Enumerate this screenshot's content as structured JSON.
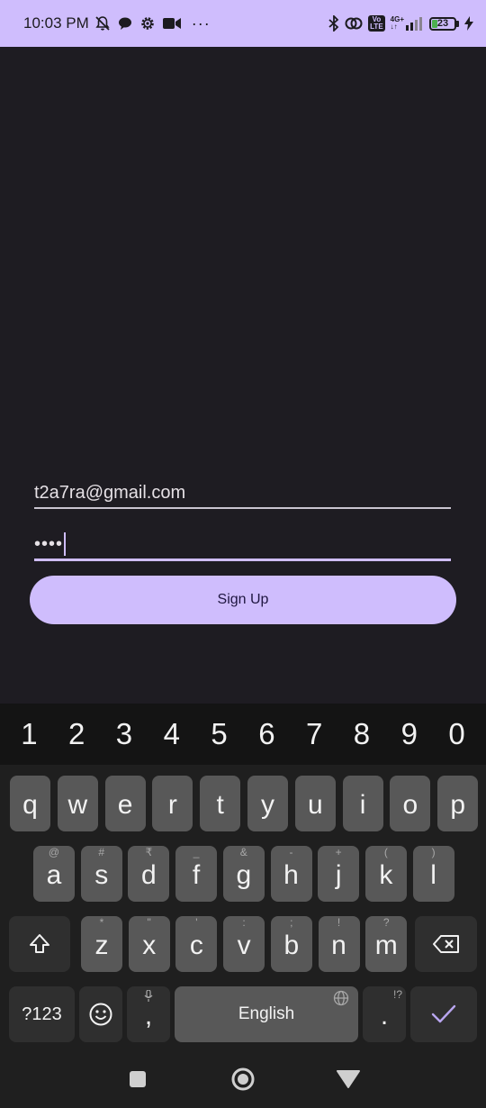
{
  "status_bar": {
    "time": "10:03 PM",
    "left_icons": [
      "mute-notification-icon",
      "chat-bubble-icon",
      "settings-gear-icon",
      "video-camera-icon",
      "more-dots-icon"
    ],
    "more_dots": "···",
    "right_icons": [
      "bluetooth-icon",
      "hotspot-icon",
      "volte-icon",
      "signal-icon",
      "battery-icon",
      "charging-icon"
    ],
    "network_top": "4G+",
    "network_bottom": "↓↑",
    "volte_label_top": "Vo",
    "volte_label_bottom": "LTE",
    "battery_level": "23",
    "battery_fraction": 0.23,
    "battery_color": "#4caf50"
  },
  "form": {
    "email_value": "t2a7ra@gmail.com",
    "password_value": "••••",
    "signup_label": "Sign Up"
  },
  "colors": {
    "accent": "#cfbdfd",
    "background": "#1e1c22"
  },
  "keyboard": {
    "numbers": [
      "1",
      "2",
      "3",
      "4",
      "5",
      "6",
      "7",
      "8",
      "9",
      "0"
    ],
    "row1": [
      "q",
      "w",
      "e",
      "r",
      "t",
      "y",
      "u",
      "i",
      "o",
      "p"
    ],
    "row2": [
      "a",
      "s",
      "d",
      "f",
      "g",
      "h",
      "j",
      "k",
      "l"
    ],
    "row2_hints": [
      "@",
      "#",
      "₹",
      "_",
      "&",
      "-",
      "+",
      "(",
      ")"
    ],
    "row3": [
      "z",
      "x",
      "c",
      "v",
      "b",
      "n",
      "m"
    ],
    "row3_hints": [
      "*",
      "\"",
      "'",
      ":",
      ";",
      "!",
      "?"
    ],
    "symbols_label": "?123",
    "comma_label": ",",
    "space_label": "English",
    "period_label": ".",
    "period_hint": "!?"
  }
}
